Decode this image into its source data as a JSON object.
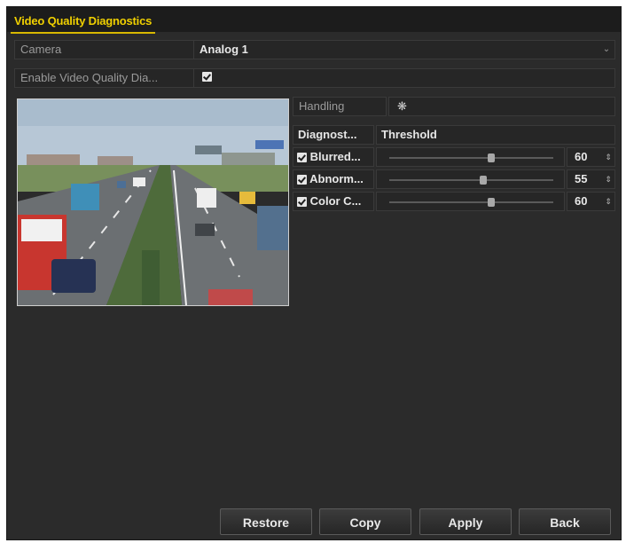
{
  "window": {
    "title": "Video Quality Diagnostics"
  },
  "camera": {
    "label": "Camera",
    "value": "Analog 1"
  },
  "enable": {
    "label": "Enable Video Quality Dia...",
    "checked": true
  },
  "handling": {
    "label": "Handling"
  },
  "table": {
    "headers": [
      "Diagnost...",
      "Threshold"
    ],
    "rows": [
      {
        "name": "Blurred...",
        "checked": true,
        "value": "60",
        "level": 60
      },
      {
        "name": "Abnorm...",
        "checked": true,
        "value": "55",
        "level": 55
      },
      {
        "name": "Color C...",
        "checked": true,
        "value": "60",
        "level": 60
      }
    ]
  },
  "buttons": {
    "restore": "Restore",
    "copy": "Copy",
    "apply": "Apply",
    "back": "Back"
  },
  "colors": {
    "title_accent": "#f0d000",
    "background": "#2b2b2b"
  },
  "icons": {
    "handling": "gear-icon",
    "dropdown": "chevron-down-icon",
    "spinner": "spinner-arrows-icon"
  }
}
